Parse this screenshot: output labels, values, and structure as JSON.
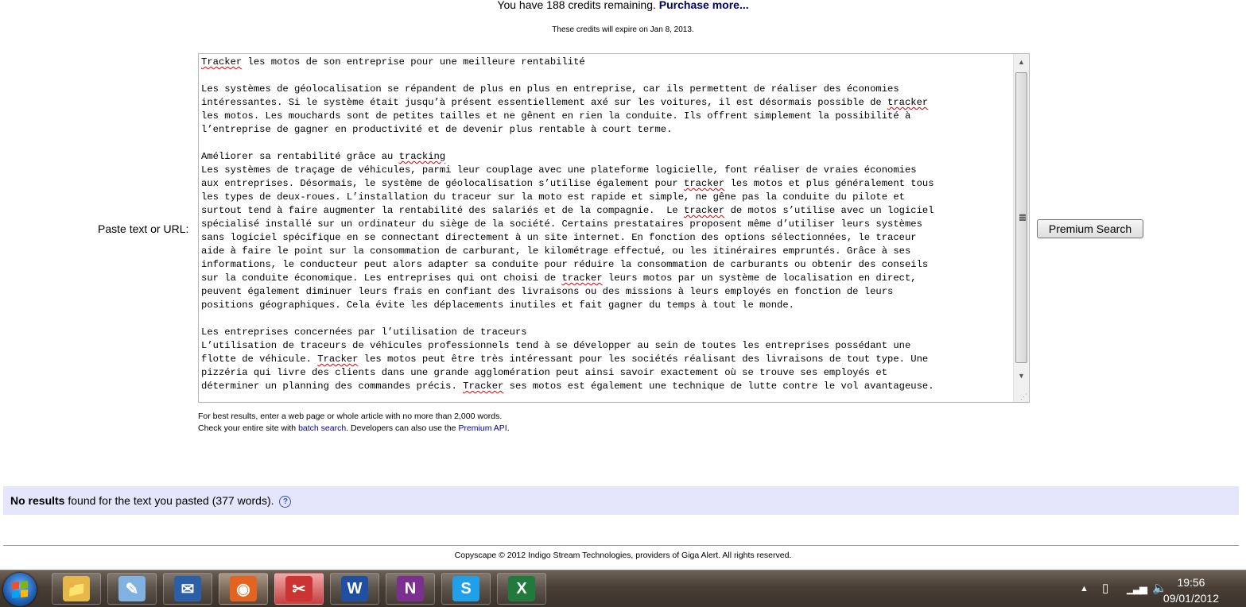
{
  "credits": {
    "text": "You have 188 credits remaining.",
    "link": "Purchase more...",
    "expire": "These credits will expire on Jan 8, 2013."
  },
  "form": {
    "label": "Paste text or URL:",
    "button": "Premium Search"
  },
  "textarea_lines": [
    [
      {
        "t": "Tracker",
        "sq": true
      },
      {
        "t": " les motos de son entreprise pour une meilleure rentabilité"
      }
    ],
    [],
    [
      {
        "t": "Les systèmes de géolocalisation se répandent de plus en plus en entreprise, car ils permettent de réaliser des économies"
      }
    ],
    [
      {
        "t": "intéressantes. Si le système était jusqu’à présent essentiellement axé sur les voitures, il est désormais possible de "
      },
      {
        "t": "tracker",
        "sq": true
      }
    ],
    [
      {
        "t": "les motos. Les mouchards sont de petites tailles et ne gênent en rien la conduite. Ils offrent simplement la possibilité à"
      }
    ],
    [
      {
        "t": "l’entreprise de gagner en productivité et de devenir plus rentable à court terme."
      }
    ],
    [],
    [
      {
        "t": "Améliorer sa rentabilité grâce au "
      },
      {
        "t": "tracking",
        "sq": true
      }
    ],
    [
      {
        "t": "Les systèmes de traçage de véhicules, parmi leur couplage avec une plateforme logicielle, font réaliser de vraies économies"
      }
    ],
    [
      {
        "t": "aux entreprises. Désormais, le système de géolocalisation s’utilise également pour "
      },
      {
        "t": "tracker",
        "sq": true
      },
      {
        "t": " les motos et plus généralement tous"
      }
    ],
    [
      {
        "t": "les types de deux-roues. L’installation du traceur sur la moto est rapide et simple, ne gêne pas la conduite du pilote et"
      }
    ],
    [
      {
        "t": "surtout tend à faire augmenter la rentabilité des salariés et de la compagnie.  Le "
      },
      {
        "t": "tracker",
        "sq": true
      },
      {
        "t": " de motos s’utilise avec un logiciel"
      }
    ],
    [
      {
        "t": "spécialisé installé sur un ordinateur du siège de la société. Certains prestataires proposent même d’utiliser leurs systèmes"
      }
    ],
    [
      {
        "t": "sans logiciel spécifique en se connectant directement à un site internet. En fonction des options sélectionnées, le traceur"
      }
    ],
    [
      {
        "t": "aide à faire le point sur la consommation de carburant, le kilométrage effectué, ou les itinéraires empruntés. Grâce à ses"
      }
    ],
    [
      {
        "t": "informations, le conducteur peut alors adapter sa conduite pour réduire la consommation de carburants ou obtenir des conseils"
      }
    ],
    [
      {
        "t": "sur la conduite économique. Les entreprises qui ont choisi de "
      },
      {
        "t": "tracker",
        "sq": true
      },
      {
        "t": " leurs motos par un système de localisation en direct,"
      }
    ],
    [
      {
        "t": "peuvent également diminuer leurs frais en confiant des livraisons ou des missions à leurs employés en fonction de leurs"
      }
    ],
    [
      {
        "t": "positions géographiques. Cela évite les déplacements inutiles et fait gagner du temps à tout le monde."
      }
    ],
    [],
    [
      {
        "t": "Les entreprises concernées par l’utilisation de traceurs"
      }
    ],
    [
      {
        "t": "L’utilisation de traceurs de véhicules professionnels tend à se développer au sein de toutes les entreprises possédant une"
      }
    ],
    [
      {
        "t": "flotte de véhicule. "
      },
      {
        "t": "Tracker",
        "sq": true
      },
      {
        "t": " les motos peut être très intéressant pour les sociétés réalisant des livraisons de tout type. Une"
      }
    ],
    [
      {
        "t": "pizzéria qui livre des clients dans une grande agglomération peut ainsi savoir exactement où se trouve ses employés et"
      }
    ],
    [
      {
        "t": "déterminer un planning des commandes précis. "
      },
      {
        "t": "Tracker",
        "sq": true
      },
      {
        "t": " ses motos est également une technique de lutte contre le vol avantageuse."
      }
    ]
  ],
  "hints": {
    "line1": "For best results, enter a web page or whole article with no more than 2,000 words.",
    "line2_a": "Check your entire site with ",
    "batch": "batch search",
    "line2_b": ". Developers can also use the ",
    "api": "Premium API",
    "line2_c": "."
  },
  "result": {
    "bold": "No results",
    "rest": " found for the text you pasted (377 words).",
    "help": "?"
  },
  "footer": "Copyscape © 2012 Indigo Stream Technologies, providers of Giga Alert. All rights reserved.",
  "taskbar": {
    "apps": [
      {
        "name": "explorer",
        "glyph": "📁",
        "color": "#e6b84a"
      },
      {
        "name": "notepad",
        "glyph": "✎",
        "color": "#7fb2e0"
      },
      {
        "name": "thunderbird",
        "glyph": "✉",
        "color": "#2b5fa8"
      },
      {
        "name": "firefox",
        "glyph": "◉",
        "color": "#e4631e"
      },
      {
        "name": "snipping-tool",
        "glyph": "✂",
        "color": "#cc3333"
      },
      {
        "name": "word",
        "glyph": "W",
        "color": "#1f4fa3"
      },
      {
        "name": "onenote",
        "glyph": "N",
        "color": "#7b2f8f"
      },
      {
        "name": "skype",
        "glyph": "S",
        "color": "#1fa0e8"
      },
      {
        "name": "excel",
        "glyph": "X",
        "color": "#207a3b"
      }
    ],
    "time": "19:56",
    "date": "09/01/2012"
  }
}
